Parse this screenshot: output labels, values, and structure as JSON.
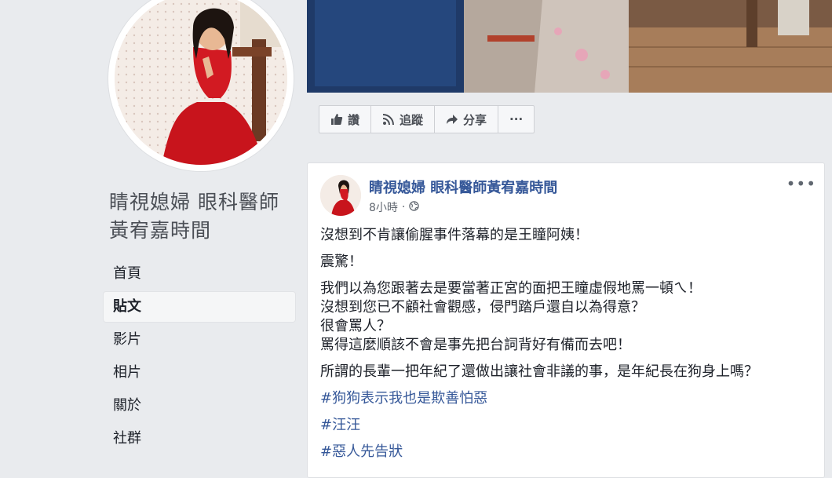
{
  "page": {
    "name_line1": "睛視媳婦 眼科醫師",
    "name_line2": "黃宥嘉時間"
  },
  "sidebar": {
    "items": [
      {
        "label": "首頁"
      },
      {
        "label": "貼文"
      },
      {
        "label": "影片"
      },
      {
        "label": "相片"
      },
      {
        "label": "關於"
      },
      {
        "label": "社群"
      }
    ]
  },
  "actions": {
    "like": "讚",
    "follow": "追蹤",
    "share": "分享",
    "more": "···"
  },
  "post": {
    "author": "睛視媳婦 眼科醫師黃宥嘉時間",
    "time": "8小時",
    "separator": "·",
    "more": "•••",
    "para1": "沒想到不肯讓偷腥事件落幕的是王瞳阿姨！",
    "para2": "震驚！",
    "para3_lines": [
      "我們以為您跟著去是要當著正宮的面把王瞳虛假地罵一頓ㄟ！",
      "沒想到您已不顧社會觀感，侵門踏戶還自以為得意？",
      "很會罵人？",
      "罵得這麼順該不會是事先把台詞背好有備而去吧！"
    ],
    "para4": "所謂的長輩一把年紀了還做出讓社會非議的事，是年紀長在狗身上嗎？",
    "tags": [
      "#狗狗表示我也是欺善怕惡",
      "#汪汪",
      "#惡人先告狀"
    ]
  }
}
